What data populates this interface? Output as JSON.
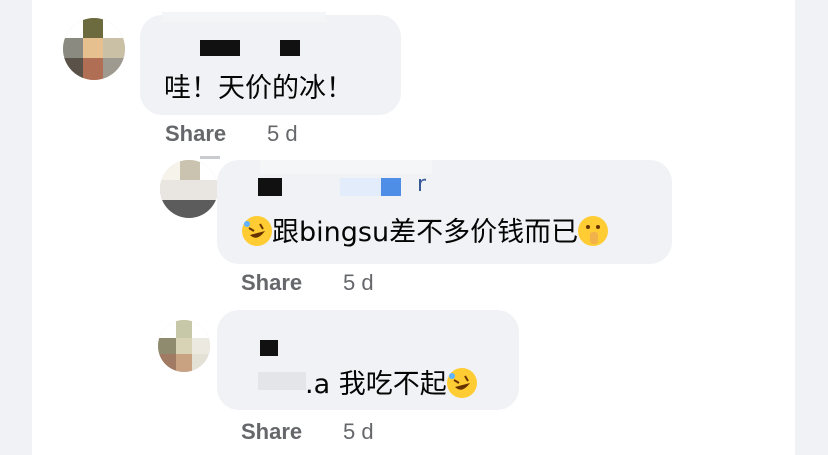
{
  "comments": [
    {
      "text": "哇！天价的冰！",
      "action": "Share",
      "time": "5 d"
    },
    {
      "text_before_emoji": "",
      "text_body": "跟bingsu差不多价钱而已",
      "lead_emoji": "rolling-on-floor-laughing",
      "trail_emoji": "face-with-hand-over-mouth",
      "name_fragment": "r",
      "action": "Share",
      "time": "5 d"
    },
    {
      "text_body": ".a 我吃不起",
      "trail_emoji": "rolling-on-floor-laughing",
      "action": "Share",
      "time": "5 d"
    }
  ],
  "colors": {
    "page_bg": "#f0f2f5",
    "bubble_bg": "#f0f2f5",
    "secondary_text": "#65676b",
    "primary_text": "#050505"
  }
}
